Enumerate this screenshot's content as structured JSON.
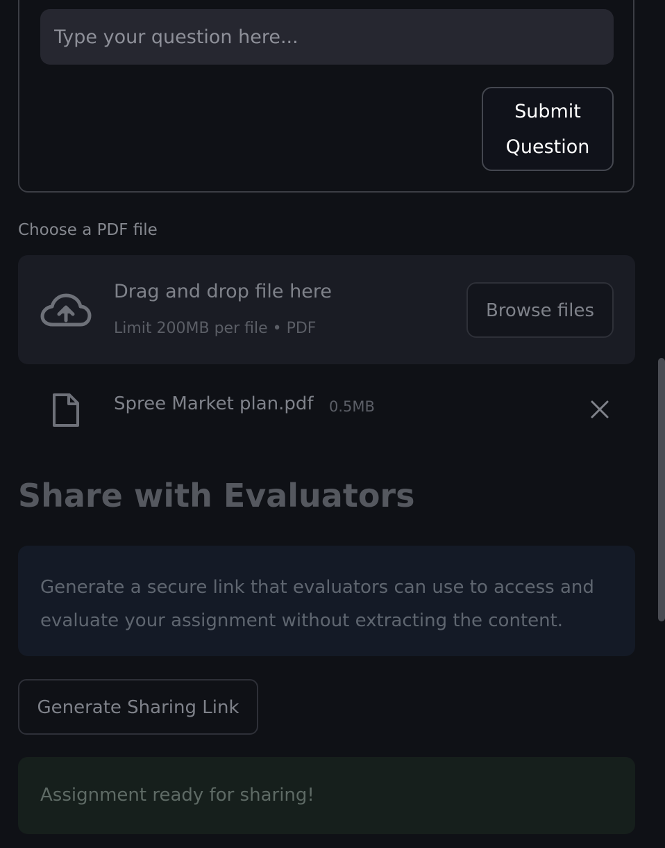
{
  "question_form": {
    "input_placeholder": "Type your question here...",
    "input_value": "",
    "submit_label": "Submit Question"
  },
  "uploader": {
    "label": "Choose a PDF file",
    "drop_title": "Drag and drop file here",
    "drop_limit": "Limit 200MB per file • PDF",
    "browse_label": "Browse files",
    "upload_icon": "cloud-upload-icon",
    "file": {
      "name": "Spree Market plan.pdf",
      "size": "0.5MB",
      "icon": "file-icon",
      "remove_icon": "close-icon"
    }
  },
  "share_section": {
    "heading": "Share with Evaluators",
    "info_text": "Generate a secure link that evaluators can use to access and evaluate your assignment without extracting the content.",
    "button_label": "Generate Sharing Link",
    "success_message": "Assignment ready for sharing!"
  },
  "colors": {
    "background": "#0f1116",
    "input_bg": "#262730",
    "info_bg": "#141a26",
    "success_bg": "#161f1c"
  }
}
